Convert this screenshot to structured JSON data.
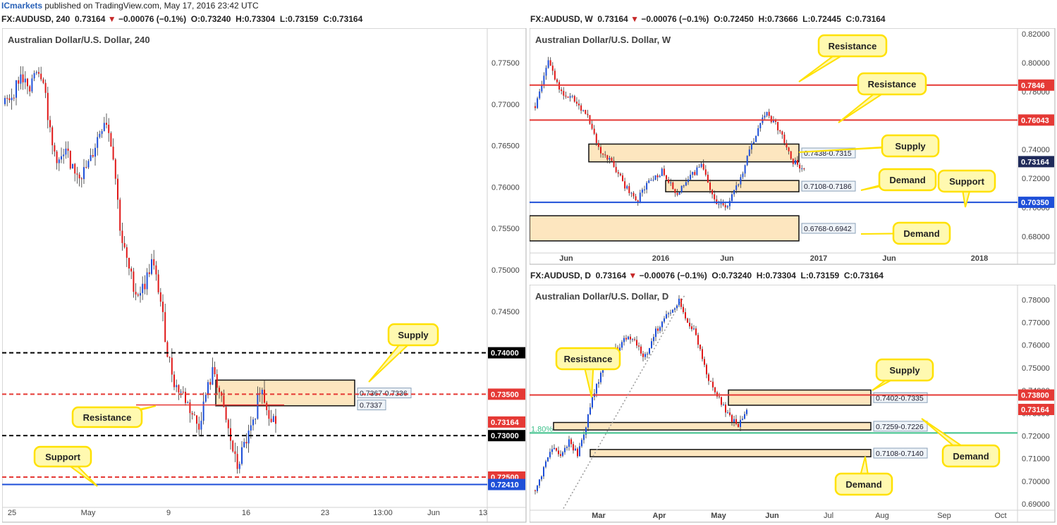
{
  "header": {
    "brand": "ICmarkets",
    "published": "published on TradingView.com, May 17, 2016 23:42 UTC"
  },
  "panels": [
    {
      "id": "p240",
      "symbol_line": {
        "symbol": "FX:AUDUSD, 240",
        "last": "0.73164",
        "arrow": "▼",
        "change": "−0.00076 (−0.1%)",
        "o": "O:0.73240",
        "h": "H:0.73304",
        "l": "L:0.73159",
        "c": "C:0.73164"
      },
      "chart_data": {
        "type": "candlestick",
        "title": "Australian Dollar/U.S. Dollar, 240",
        "ylim": [
          0.721,
          0.779
        ],
        "y_ticks": [
          "0.77500",
          "0.77000",
          "0.76500",
          "0.76000",
          "0.75500",
          "0.75000",
          "0.74500",
          "0.74000",
          "0.73500",
          "0.73000",
          "0.72500",
          "0.72410"
        ],
        "x_ticks": [
          "25",
          "May",
          "9",
          "16",
          "23",
          "13:00",
          "Jun",
          "13"
        ],
        "series_close_path": [
          0.77,
          0.7712,
          0.7735,
          0.7718,
          0.7745,
          0.7732,
          0.765,
          0.763,
          0.764,
          0.762,
          0.7615,
          0.763,
          0.766,
          0.7685,
          0.764,
          0.754,
          0.75,
          0.747,
          0.748,
          0.751,
          0.747,
          0.74,
          0.736,
          0.735,
          0.733,
          0.731,
          0.735,
          0.738,
          0.734,
          0.73,
          0.726,
          0.729,
          0.731,
          0.736,
          0.733,
          0.7316
        ],
        "levels": [
          {
            "value": 0.74,
            "label": "0.74000",
            "style": "dashed",
            "color": "#000000"
          },
          {
            "value": 0.735,
            "label": "0.73500",
            "style": "dashed",
            "color": "#e53935"
          },
          {
            "value": 0.73,
            "label": "0.73000",
            "style": "dashed",
            "color": "#000000"
          },
          {
            "value": 0.725,
            "label": "0.72500",
            "style": "dashed",
            "color": "#e53935"
          },
          {
            "value": 0.7241,
            "label": "0.72410",
            "style": "solid",
            "color": "#1e4fd8"
          },
          {
            "value": 0.73164,
            "label": "0.73164",
            "style": "tag",
            "color": "#e53935"
          }
        ],
        "zones": [
          {
            "top": 0.7367,
            "bottom": 0.7336,
            "label": "0.7367-0.7336"
          }
        ],
        "line_labels": [
          {
            "value": 0.7337,
            "label": "0.7337"
          }
        ],
        "callouts": [
          {
            "text": "Supply"
          },
          {
            "text": "Resistance"
          },
          {
            "text": "Support"
          }
        ]
      }
    },
    {
      "id": "pW",
      "symbol_line": {
        "symbol": "FX:AUDUSD, W",
        "last": "0.73164",
        "arrow": "▼",
        "change": "−0.00076 (−0.1%)",
        "o": "O:0.72450",
        "h": "H:0.73666",
        "l": "L:0.72445",
        "c": "C:0.73164"
      },
      "chart_data": {
        "type": "candlestick",
        "title": "Australian Dollar/U.S. Dollar, W",
        "ylim": [
          0.666,
          0.823
        ],
        "y_ticks": [
          "0.82000",
          "0.80000",
          "0.78000",
          "0.76000",
          "0.74000",
          "0.72000",
          "0.70000",
          "0.68000"
        ],
        "x_ticks": [
          "Jun",
          "2016",
          "Jun",
          "2017",
          "Jun",
          "2018"
        ],
        "series_close_path": [
          0.77,
          0.8,
          0.78,
          0.775,
          0.765,
          0.74,
          0.73,
          0.715,
          0.705,
          0.72,
          0.725,
          0.71,
          0.72,
          0.73,
          0.705,
          0.7,
          0.72,
          0.745,
          0.765,
          0.755,
          0.733,
          0.725
        ],
        "levels": [
          {
            "value": 0.7846,
            "label": "0.7846",
            "style": "solid",
            "color": "#e53935"
          },
          {
            "value": 0.76043,
            "label": "0.76043",
            "style": "solid",
            "color": "#e53935"
          },
          {
            "value": 0.73164,
            "label": "0.73164",
            "style": "tag",
            "color": "#1f2a5a"
          },
          {
            "value": 0.7035,
            "label": "0.70350",
            "style": "solid",
            "color": "#1e4fd8"
          }
        ],
        "zones": [
          {
            "top": 0.7438,
            "bottom": 0.7315,
            "label": "0.7438-0.7315"
          },
          {
            "top": 0.7186,
            "bottom": 0.7108,
            "label": "0.7108-0.7186"
          },
          {
            "top": 0.6942,
            "bottom": 0.6768,
            "label": "0.6768-0.6942"
          }
        ],
        "callouts": [
          {
            "text": "Resistance"
          },
          {
            "text": "Resistance"
          },
          {
            "text": "Supply"
          },
          {
            "text": "Demand"
          },
          {
            "text": "Support"
          },
          {
            "text": "Demand"
          }
        ]
      }
    },
    {
      "id": "pD",
      "symbol_line": {
        "symbol": "FX:AUDUSD, D",
        "last": "0.73164",
        "arrow": "▼",
        "change": "−0.00076 (−0.1%)",
        "o": "O:0.73240",
        "h": "H:0.73304",
        "l": "L:0.73159",
        "c": "C:0.73164"
      },
      "chart_data": {
        "type": "candlestick",
        "title": "Australian Dollar/U.S. Dollar, D",
        "ylim": [
          0.686,
          0.786
        ],
        "y_ticks": [
          "0.78000",
          "0.77000",
          "0.76000",
          "0.75000",
          "0.74000",
          "0.73000",
          "0.72000",
          "0.71000",
          "0.70000",
          "0.69000"
        ],
        "x_ticks": [
          "Mar",
          "Apr",
          "May",
          "Jun",
          "Jul",
          "Aug",
          "Sep",
          "Oct"
        ],
        "series_close_path": [
          0.696,
          0.705,
          0.715,
          0.71,
          0.718,
          0.712,
          0.725,
          0.74,
          0.75,
          0.755,
          0.76,
          0.765,
          0.76,
          0.755,
          0.765,
          0.77,
          0.775,
          0.78,
          0.77,
          0.765,
          0.75,
          0.74,
          0.735,
          0.728,
          0.725,
          0.7316
        ],
        "levels": [
          {
            "value": 0.738,
            "label": "0.73800",
            "style": "solid",
            "color": "#e53935"
          },
          {
            "value": 0.73164,
            "label": "0.73164",
            "style": "tag",
            "color": "#e53935"
          },
          {
            "value": 0.7213,
            "label": "1.80%",
            "style": "solid",
            "color": "#3cc08a"
          }
        ],
        "zones": [
          {
            "top": 0.7402,
            "bottom": 0.7335,
            "label": "0.7402-0.7335"
          },
          {
            "top": 0.7259,
            "bottom": 0.7226,
            "label": "0.7259-0.7226"
          },
          {
            "top": 0.714,
            "bottom": 0.7108,
            "label": "0.7108-0.7140"
          }
        ],
        "callouts": [
          {
            "text": "Resistance"
          },
          {
            "text": "Supply"
          },
          {
            "text": "Demand"
          },
          {
            "text": "Demand"
          }
        ]
      }
    }
  ]
}
